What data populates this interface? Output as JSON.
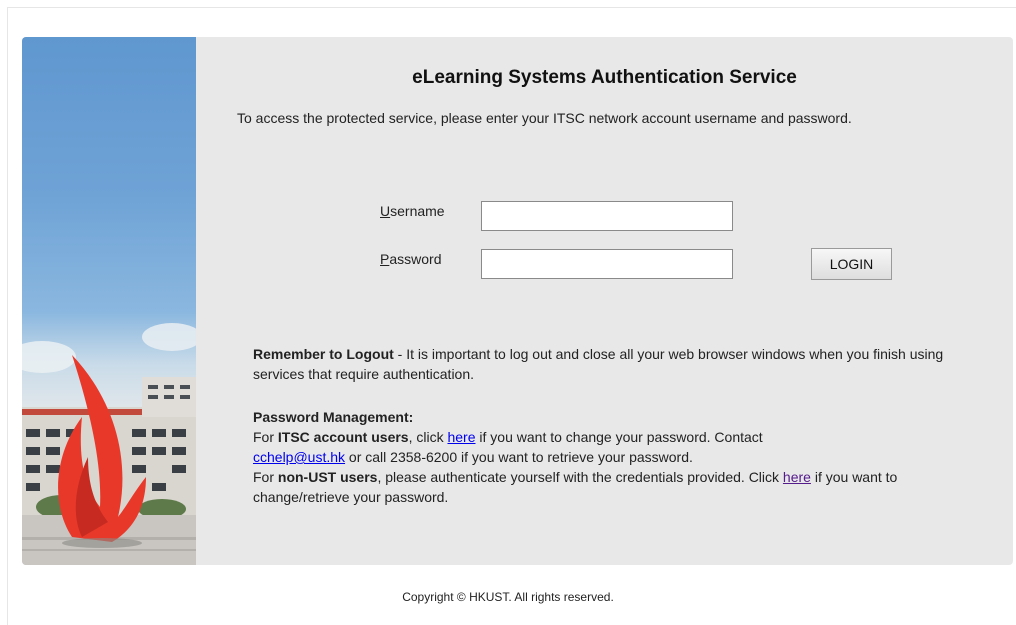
{
  "page": {
    "title": "eLearning Systems Authentication Service",
    "intro": "To access the protected service, please enter your ITSC network account username and password."
  },
  "form": {
    "username_label_accesskey": "U",
    "username_label_rest": "sername",
    "username_value": "",
    "password_label_accesskey": "P",
    "password_label_rest": "assword",
    "password_value": "",
    "login_label": "LOGIN"
  },
  "logout_notice": {
    "heading": "Remember to Logout",
    "text": " - It is important to log out and close all your web browser windows when you finish using services that require authentication."
  },
  "password_management": {
    "heading": "Password Management:",
    "itsc_prefix": "For ",
    "itsc_bold": "ITSC account users",
    "itsc_mid": ", click ",
    "itsc_link": "here",
    "itsc_after": " if you want to change your password. Contact ",
    "email_link": "cchelp@ust.hk",
    "phone_text": " or call 2358-6200 if you want to retrieve your password.",
    "nonust_prefix": "For ",
    "nonust_bold": "non-UST users",
    "nonust_mid": ", please authenticate yourself with the credentials provided. Click ",
    "nonust_link": "here",
    "nonust_after": " if you want to change/retrieve your password."
  },
  "footer": {
    "copyright": "Copyright © HKUST. All rights reserved."
  },
  "colors": {
    "panel_bg": "#e8e8e8",
    "link": "#0000ee",
    "visited_link": "#551a8b",
    "sculpture_red": "#e8382a"
  }
}
